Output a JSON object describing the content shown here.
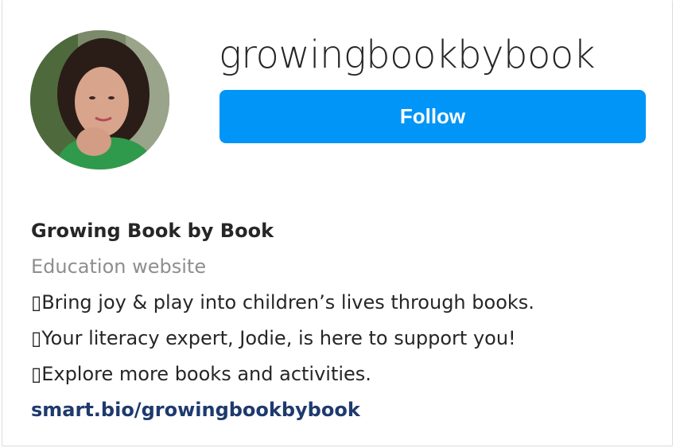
{
  "profile": {
    "username": "growingbookbybook",
    "follow_label": "Follow",
    "full_name": "Growing Book by Book",
    "category": "Education website",
    "bio_lines": [
      "▯Bring joy & play into children’s lives through books.",
      "▯Your literacy expert, Jodie, is here to support you!",
      "▯Explore more books and activities."
    ],
    "link": "smart.bio/growingbookbybook"
  },
  "colors": {
    "follow_button": "#0095f6",
    "link": "#1e3a6e",
    "secondary_text": "#8e8e8e"
  }
}
